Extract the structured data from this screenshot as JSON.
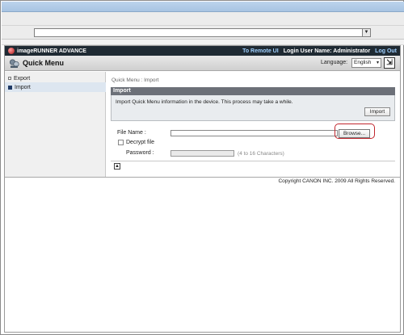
{
  "browser": {
    "address_value": "",
    "dropdown_glyph": "▼"
  },
  "topbar": {
    "brand": "imageRUNNER ADVANCE",
    "to_remote_ui": "To Remote UI",
    "login_user": "Login User Name: Administrator",
    "log_out": "Log Out"
  },
  "header": {
    "title": "Quick Menu",
    "language_label": "Language:",
    "language_value": "English",
    "language_caret": "▾",
    "apply_glyph": "⇲"
  },
  "sidebar": {
    "items": [
      {
        "label": "Export"
      },
      {
        "label": "Import"
      }
    ]
  },
  "main": {
    "breadcrumb": "Quick Menu : Import",
    "section_title": "Import",
    "description": "Import Quick Menu information in the device. This process may take a while.",
    "import_button": "Import",
    "file_name_label": "File Name :",
    "file_name_value": "",
    "browse_button": "Browse...",
    "decrypt_label": "Decrypt file",
    "password_label": "Password :",
    "password_hint": "(4 to 16 Characters)",
    "top_glyph": "▲"
  },
  "footer": {
    "copyright": "Copyright CANON INC. 2009 All Rights Reserved."
  },
  "colors": {
    "topbar": "#1f2a33",
    "section_header": "#6c7078",
    "highlight": "#c0262d",
    "link": "#9fd0ff"
  }
}
